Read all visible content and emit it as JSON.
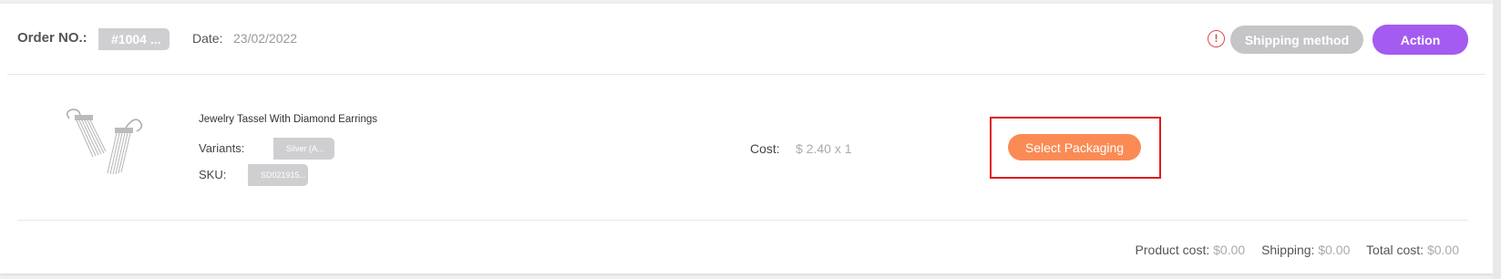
{
  "order": {
    "label": "Order NO.:",
    "number": "#1004 ...",
    "date_label": "Date:",
    "date_value": "23/02/2022"
  },
  "header_actions": {
    "alert_icon": "exclamation-circle-icon",
    "alert_glyph": "!",
    "shipping_method_label": "Shipping method",
    "action_label": "Action"
  },
  "product": {
    "name": "Jewelry Tassel With Diamond Earrings",
    "variants_label": "Variants:",
    "variant_value": "Silver (A...",
    "sku_label": "SKU:",
    "sku_value": "SD021915...",
    "cost_label": "Cost:",
    "cost_value": "$ 2.40 x 1",
    "select_packaging_label": "Select Packaging"
  },
  "totals": {
    "product_cost_label": "Product cost:",
    "product_cost_value": "$0.00",
    "shipping_label": "Shipping:",
    "shipping_value": "$0.00",
    "total_cost_label": "Total cost:",
    "total_cost_value": "$0.00"
  },
  "colors": {
    "action_button": "#a45bf0",
    "select_packaging_button": "#fb8b55",
    "shipping_button": "#c5c5c8",
    "highlight_border": "#e01b1b",
    "alert": "#e04848"
  }
}
